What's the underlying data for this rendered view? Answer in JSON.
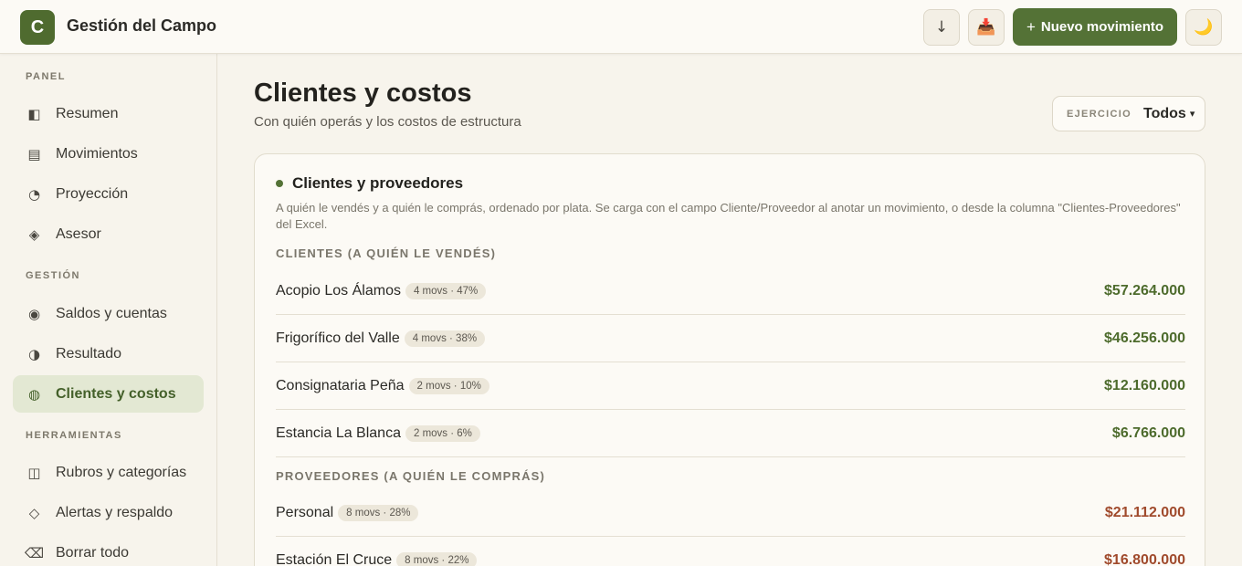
{
  "header": {
    "logo_letter": "C",
    "app_title": "Gestión del Campo",
    "download_icon": "↓",
    "import_icon": "📥",
    "new_button_plus": "+",
    "new_button_label": "Nuevo movimiento",
    "theme_icon": "🌙"
  },
  "sidebar": {
    "sections": [
      {
        "label": "PANEL",
        "items": [
          {
            "icon": "◧",
            "label": "Resumen"
          },
          {
            "icon": "▤",
            "label": "Movimientos"
          },
          {
            "icon": "◔",
            "label": "Proyección"
          },
          {
            "icon": "◈",
            "label": "Asesor"
          }
        ]
      },
      {
        "label": "GESTIÓN",
        "items": [
          {
            "icon": "◉",
            "label": "Saldos y cuentas"
          },
          {
            "icon": "◑",
            "label": "Resultado"
          },
          {
            "icon": "◍",
            "label": "Clientes y costos",
            "active": true
          }
        ]
      },
      {
        "label": "HERRAMIENTAS",
        "items": [
          {
            "icon": "◫",
            "label": "Rubros y categorías"
          },
          {
            "icon": "◇",
            "label": "Alertas y respaldo"
          },
          {
            "icon": "⌫",
            "label": "Borrar todo"
          }
        ]
      }
    ]
  },
  "main": {
    "title": "Clientes y costos",
    "subtitle": "Con quién operás y los costos de estructura",
    "ejercicio": {
      "label": "EJERCICIO",
      "value": "Todos",
      "chevron": "▾"
    },
    "card": {
      "title": "Clientes y proveedores",
      "description": "A quién le vendés y a quién le comprás, ordenado por plata. Se carga con el campo Cliente/Proveedor al anotar un movimiento, o desde la columna \"Clientes-Proveedores\" del Excel.",
      "clients_label": "CLIENTES (A QUIÉN LE VENDÉS)",
      "clients": [
        {
          "name": "Acopio Los Álamos",
          "badge": "4 movs · 47%",
          "amount": "$57.264.000"
        },
        {
          "name": "Frigorífico del Valle",
          "badge": "4 movs · 38%",
          "amount": "$46.256.000"
        },
        {
          "name": "Consignataria Peña",
          "badge": "2 movs · 10%",
          "amount": "$12.160.000"
        },
        {
          "name": "Estancia La Blanca",
          "badge": "2 movs · 6%",
          "amount": "$6.766.000"
        }
      ],
      "suppliers_label": "PROVEEDORES (A QUIÉN LE COMPRÁS)",
      "suppliers": [
        {
          "name": "Personal",
          "badge": "8 movs · 28%",
          "amount": "$21.112.000"
        },
        {
          "name": "Estación El Cruce",
          "badge": "8 movs · 22%",
          "amount": "$16.800.000"
        }
      ]
    }
  },
  "colors": {
    "accent": "#547236",
    "positive": "#4d6b2c",
    "negative": "#a04a2c",
    "background": "#f7f4ec"
  }
}
